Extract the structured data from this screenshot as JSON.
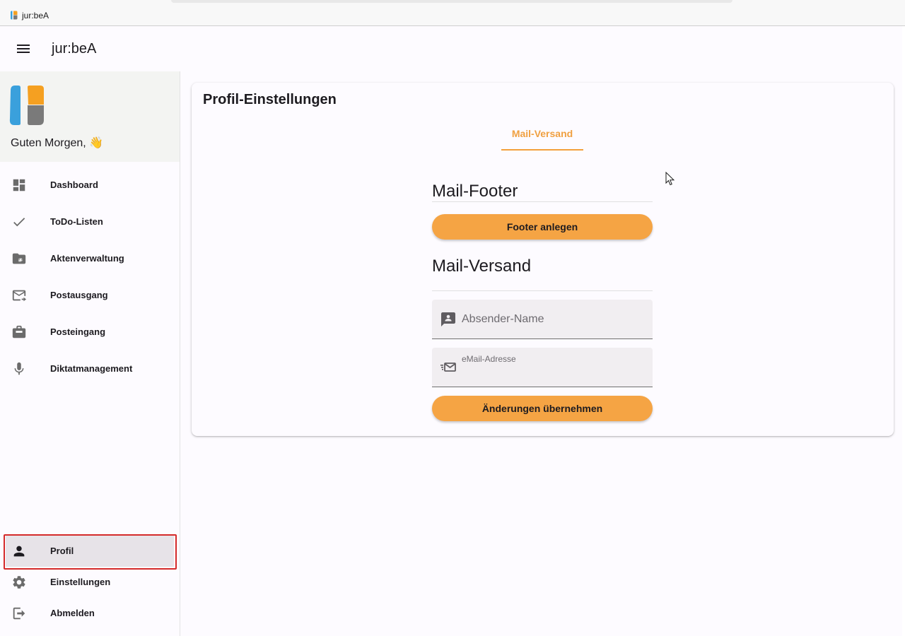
{
  "window": {
    "title": "jur:beA"
  },
  "appbar": {
    "title": "jur:beA",
    "menu_icon": "hamburger-menu-icon"
  },
  "sidebar": {
    "greeting": "Guten Morgen, 👋",
    "items": [
      {
        "label": "Dashboard",
        "icon": "dashboard-icon"
      },
      {
        "label": "ToDo-Listen",
        "icon": "check-icon"
      },
      {
        "label": "Aktenverwaltung",
        "icon": "folder-hash-icon"
      },
      {
        "label": "Postausgang",
        "icon": "mail-send-icon"
      },
      {
        "label": "Posteingang",
        "icon": "inbox-icon"
      },
      {
        "label": "Diktatmanagement",
        "icon": "microphone-icon"
      }
    ],
    "bottom_items": [
      {
        "label": "Profil",
        "icon": "person-icon",
        "active": true
      },
      {
        "label": "Einstellungen",
        "icon": "gear-icon"
      },
      {
        "label": "Abmelden",
        "icon": "logout-icon"
      }
    ]
  },
  "main": {
    "card_title": "Profil-Einstellungen",
    "tab": "Mail-Versand",
    "footer_section": {
      "title": "Mail-Footer",
      "button": "Footer anlegen"
    },
    "mail_section": {
      "title": "Mail-Versand",
      "sender_name_placeholder": "Absender-Name",
      "email_label": "eMail-Adresse",
      "email_value": "",
      "submit_button": "Änderungen übernehmen"
    }
  },
  "colors": {
    "accent": "#f5a444",
    "tab_accent": "#f0a040",
    "highlight": "#d42a2a",
    "logo_blue": "#3aa0dc",
    "logo_orange": "#f5a021"
  }
}
